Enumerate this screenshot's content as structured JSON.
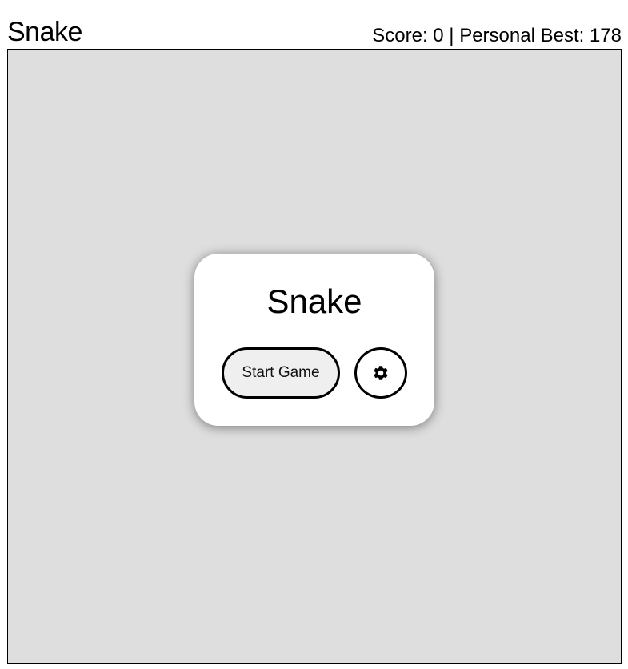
{
  "header": {
    "title": "Snake",
    "score_text": "Score: 0 | Personal Best: 178"
  },
  "menu": {
    "title": "Snake",
    "start_label": "Start Game",
    "settings_icon": "gear-icon"
  },
  "colors": {
    "board_background": "#dedede",
    "card_background": "#ffffff",
    "start_button_background": "#efefef",
    "border": "#000000"
  }
}
